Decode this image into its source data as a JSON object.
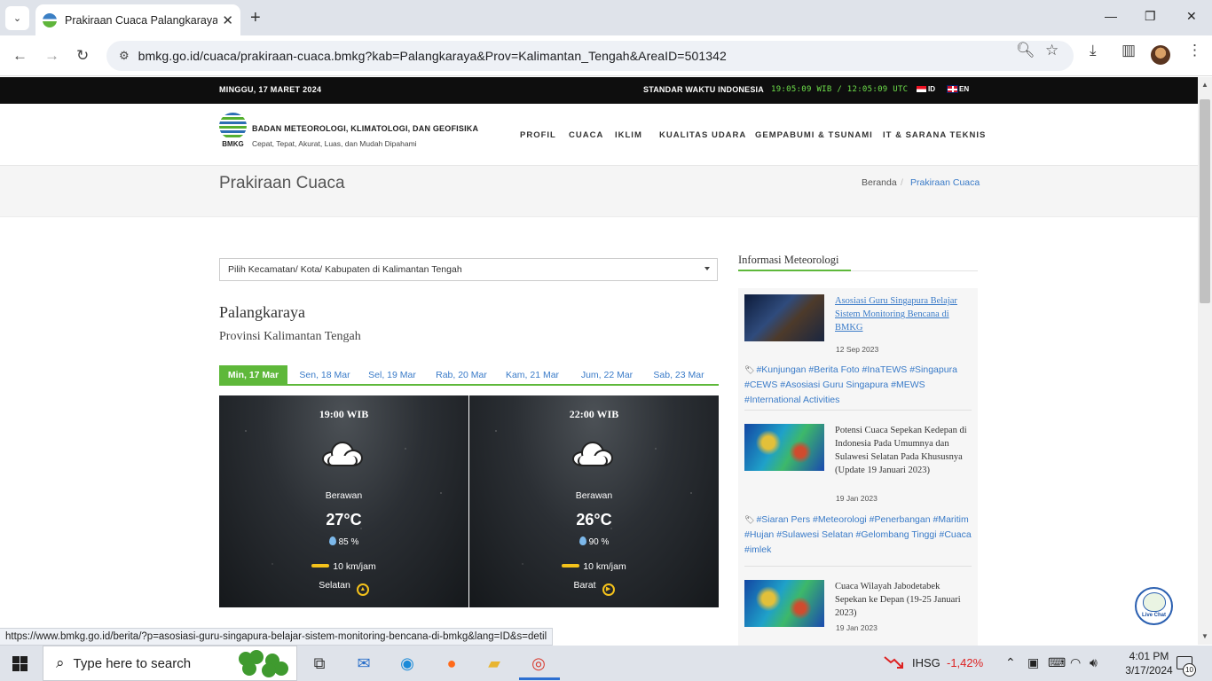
{
  "browser": {
    "tab_title": "Prakiraan Cuaca Palangkaraya -",
    "url": "bmkg.go.id/cuaca/prakiraan-cuaca.bmkg?kab=Palangkaraya&Prov=Kalimantan_Tengah&AreaID=501342",
    "status_url": "https://www.bmkg.go.id/berita/?p=asosiasi-guru-singapura-belajar-sistem-monitoring-bencana-di-bmkg&lang=ID&s=detil"
  },
  "topbar": {
    "date": "MINGGU, 17 MARET 2024",
    "standard_time_label": "STANDAR WAKTU INDONESIA",
    "clock": "19:05:09 WIB / 12:05:09 UTC",
    "lang_id": "ID",
    "lang_en": "EN"
  },
  "header": {
    "logo_text": "BMKG",
    "org_name": "BADAN METEOROLOGI, KLIMATOLOGI, DAN GEOFISIKA",
    "tagline": "Cepat, Tepat, Akurat, Luas, dan Mudah Dipahami",
    "nav": [
      "PROFIL",
      "CUACA",
      "IKLIM",
      "KUALITAS UDARA",
      "GEMPABUMI & TSUNAMI",
      "IT & SARANA TEKNIS"
    ]
  },
  "page": {
    "title": "Prakiraan Cuaca",
    "breadcrumb_home": "Beranda",
    "breadcrumb_sep": "/",
    "breadcrumb_current": "Prakiraan Cuaca"
  },
  "forecast": {
    "dropdown_value": "Pilih Kecamatan/ Kota/ Kabupaten di Kalimantan Tengah",
    "city": "Palangkaraya",
    "province": "Provinsi Kalimantan Tengah",
    "days": [
      "Min, 17 Mar",
      "Sen, 18 Mar",
      "Sel, 19 Mar",
      "Rab, 20 Mar",
      "Kam, 21 Mar",
      "Jum, 22 Mar",
      "Sab, 23 Mar"
    ],
    "cards": [
      {
        "time": "19:00 WIB",
        "condition": "Berawan",
        "temp": "27°C",
        "humidity": "85 %",
        "wind": "10 km/jam",
        "direction": "Selatan"
      },
      {
        "time": "22:00 WIB",
        "condition": "Berawan",
        "temp": "26°C",
        "humidity": "90 %",
        "wind": "10 km/jam",
        "direction": "Barat"
      }
    ]
  },
  "sidebar": {
    "title": "Informasi Meteorologi",
    "news": [
      {
        "title": "Asosiasi Guru Singapura Belajar Sistem Monitoring Bencana di BMKG",
        "date": "12 Sep 2023",
        "tags": "#Kunjungan #Berita Foto #InaTEWS #Singapura #CEWS #Asosiasi Guru Singapura #MEWS #International Activities"
      },
      {
        "title": "Potensi Cuaca Sepekan Kedepan di Indonesia Pada Umumnya dan Sulawesi Selatan Pada Khususnya (Update 19 Januari 2023)",
        "date": "19 Jan 2023",
        "tags": "#Siaran Pers #Meteorologi #Penerbangan #Maritim #Hujan #Sulawesi Selatan #Gelombang Tinggi #Cuaca #imlek"
      },
      {
        "title": "Cuaca Wilayah Jabodetabek Sepekan ke Depan (19-25 Januari 2023)",
        "date": "19 Jan 2023"
      }
    ]
  },
  "livechat_label": "Live Chat",
  "taskbar": {
    "search_placeholder": "Type here to search",
    "ihsg_label": "IHSG",
    "ihsg_value": "-1,42%",
    "time": "4:01 PM",
    "date": "3/17/2024",
    "notifications": "10"
  }
}
